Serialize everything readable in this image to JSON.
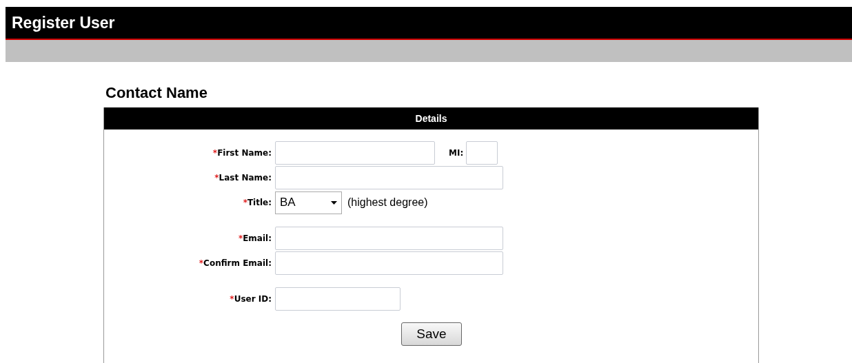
{
  "page_header": {
    "title": "Register User"
  },
  "section_title": "Contact Name",
  "panel": {
    "title": "Details",
    "groups": [
      [
        {
          "kind": "text",
          "marker": "*",
          "label": "First Name:",
          "extra": {
            "label": "MI:"
          }
        },
        {
          "kind": "text",
          "marker": "*",
          "label": "Last Name:"
        },
        {
          "kind": "select",
          "marker": "*",
          "label": "Title:",
          "value": "BA",
          "hint": "(highest degree)"
        }
      ],
      [
        {
          "kind": "text",
          "marker": "*",
          "label": "Email:"
        },
        {
          "kind": "text",
          "marker": "*",
          "label": "Confirm Email:"
        }
      ],
      [
        {
          "kind": "text",
          "marker": "*",
          "label": "User ID:"
        }
      ]
    ]
  },
  "save_button": "Save"
}
